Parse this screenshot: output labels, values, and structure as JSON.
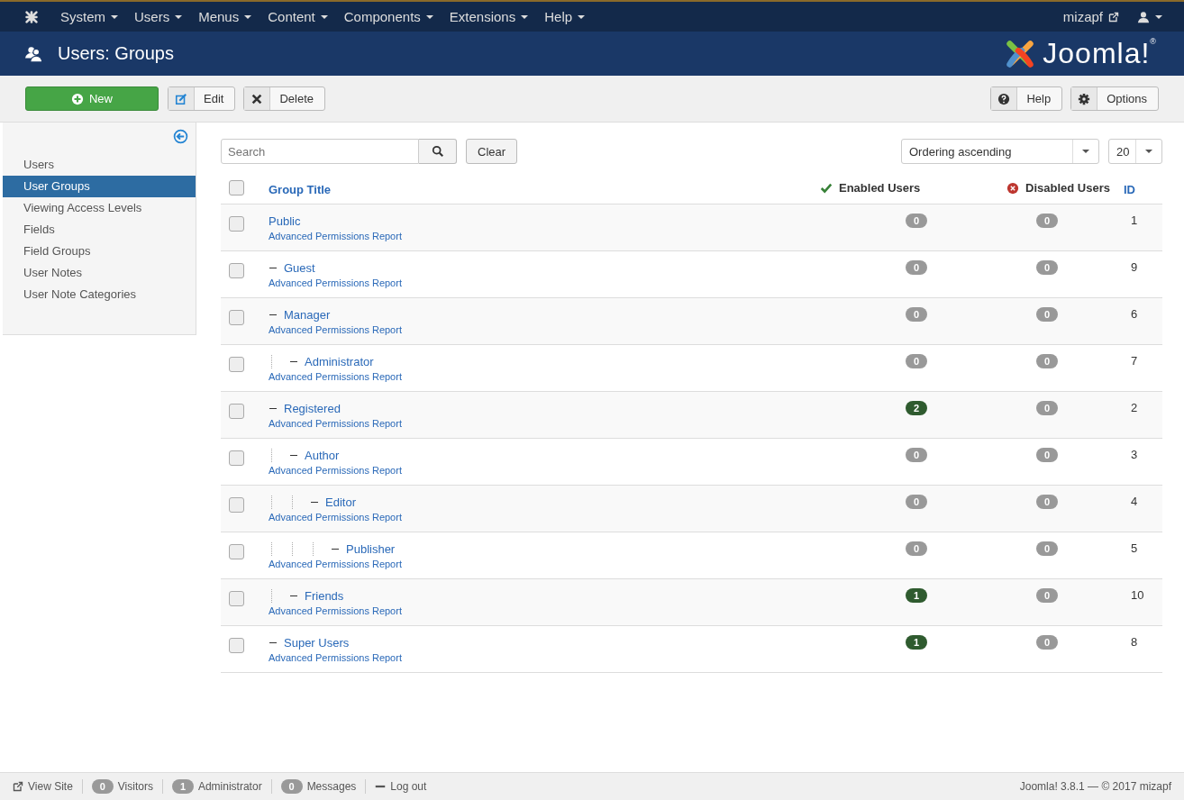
{
  "navbar": {
    "menus": [
      "System",
      "Users",
      "Menus",
      "Content",
      "Components",
      "Extensions",
      "Help"
    ],
    "user_link": "mizapf"
  },
  "header": {
    "title": "Users: Groups",
    "logo": {
      "text": "Joomla!",
      "mark": "®"
    }
  },
  "toolbar": {
    "left": [
      {
        "kind": "new",
        "label": "New"
      },
      {
        "kind": "edit",
        "label": "Edit"
      },
      {
        "kind": "delete",
        "label": "Delete"
      }
    ],
    "right": [
      {
        "kind": "help",
        "label": "Help"
      },
      {
        "kind": "options",
        "label": "Options"
      }
    ]
  },
  "sidebar": {
    "items": [
      {
        "label": "Users",
        "selected": false
      },
      {
        "label": "User Groups",
        "selected": true
      },
      {
        "label": "Viewing Access Levels",
        "selected": false
      },
      {
        "label": "Fields",
        "selected": false
      },
      {
        "label": "Field Groups",
        "selected": false
      },
      {
        "label": "User Notes",
        "selected": false
      },
      {
        "label": "User Note Categories",
        "selected": false
      }
    ]
  },
  "filters": {
    "search": {
      "placeholder": "Search"
    },
    "clear": "Clear",
    "ordering": "Ordering ascending",
    "limit": "20"
  },
  "table": {
    "columns": [
      "Group Title",
      "Enabled Users",
      "Disabled Users",
      "ID"
    ],
    "all_checked": false,
    "rows": [
      {
        "title": "Public",
        "link": "Advanced Permissions Report",
        "enabled": "0",
        "enabled_highlight": false,
        "disabled": "0",
        "id": "1",
        "checked": false,
        "children": [
          {
            "title": "Guest",
            "link": "Advanced Permissions Report",
            "enabled": "0",
            "enabled_highlight": false,
            "disabled": "0",
            "id": "9",
            "checked": false
          },
          {
            "title": "Manager",
            "link": "Advanced Permissions Report",
            "enabled": "0",
            "enabled_highlight": false,
            "disabled": "0",
            "id": "6",
            "checked": false,
            "children": [
              {
                "title": "Administrator",
                "link": "Advanced Permissions Report",
                "enabled": "0",
                "enabled_highlight": false,
                "disabled": "0",
                "id": "7",
                "checked": false
              }
            ]
          },
          {
            "title": "Registered",
            "link": "Advanced Permissions Report",
            "enabled": "2",
            "enabled_highlight": true,
            "disabled": "0",
            "id": "2",
            "checked": false,
            "children": [
              {
                "title": "Author",
                "link": "Advanced Permissions Report",
                "enabled": "0",
                "enabled_highlight": false,
                "disabled": "0",
                "id": "3",
                "checked": false,
                "children": [
                  {
                    "title": "Editor",
                    "link": "Advanced Permissions Report",
                    "enabled": "0",
                    "enabled_highlight": false,
                    "disabled": "0",
                    "id": "4",
                    "checked": false,
                    "children": [
                      {
                        "title": "Publisher",
                        "link": "Advanced Permissions Report",
                        "enabled": "0",
                        "enabled_highlight": false,
                        "disabled": "0",
                        "id": "5",
                        "checked": false
                      }
                    ]
                  }
                ]
              },
              {
                "title": "Friends",
                "link": "Advanced Permissions Report",
                "enabled": "1",
                "enabled_highlight": true,
                "disabled": "0",
                "id": "10",
                "checked": false
              }
            ]
          },
          {
            "title": "Super Users",
            "link": "Advanced Permissions Report",
            "enabled": "1",
            "enabled_highlight": true,
            "disabled": "0",
            "id": "8",
            "checked": false
          }
        ]
      }
    ]
  },
  "status_bar": {
    "items": [
      {
        "kind": "link",
        "label": "View Site"
      },
      {
        "kind": "count",
        "count": "0",
        "label": "Visitors"
      },
      {
        "kind": "count",
        "count": "1",
        "label": "Administrator"
      },
      {
        "kind": "count",
        "count": "0",
        "label": "Messages"
      },
      {
        "kind": "logout",
        "label": "Log out"
      }
    ],
    "version": "Joomla! 3.8.1 — © 2017 mizapf"
  }
}
